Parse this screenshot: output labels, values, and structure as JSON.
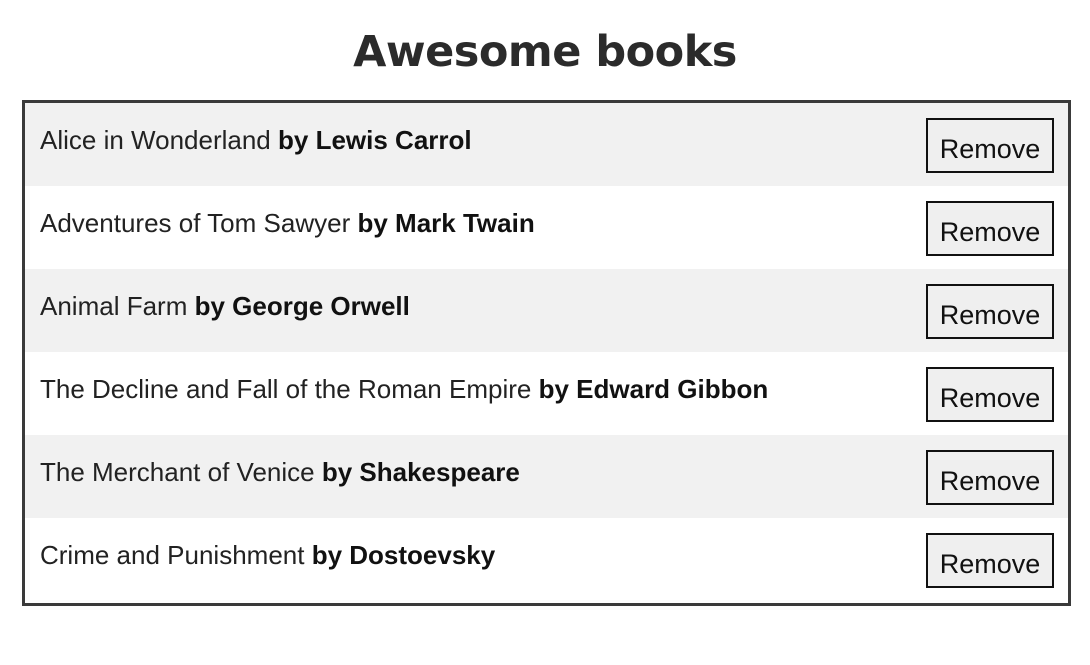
{
  "header": {
    "title": "Awesome books"
  },
  "books": [
    {
      "title": "Alice in Wonderland",
      "author": "by Lewis Carrol",
      "remove_label": "Remove"
    },
    {
      "title": "Adventures of Tom Sawyer",
      "author": "by Mark Twain",
      "remove_label": "Remove"
    },
    {
      "title": "Animal Farm",
      "author": "by George Orwell",
      "remove_label": "Remove"
    },
    {
      "title": "The Decline and Fall of the Roman Empire",
      "author": "by Edward Gibbon",
      "remove_label": "Remove"
    },
    {
      "title": "The Merchant of Venice",
      "author": "by Shakespeare",
      "remove_label": "Remove"
    },
    {
      "title": "Crime and Punishment",
      "author": "by Dostoevsky",
      "remove_label": "Remove"
    }
  ],
  "colors": {
    "row_shade": "#f1f1f1",
    "border": "#3a3a3a",
    "button_bg": "#efefef"
  }
}
